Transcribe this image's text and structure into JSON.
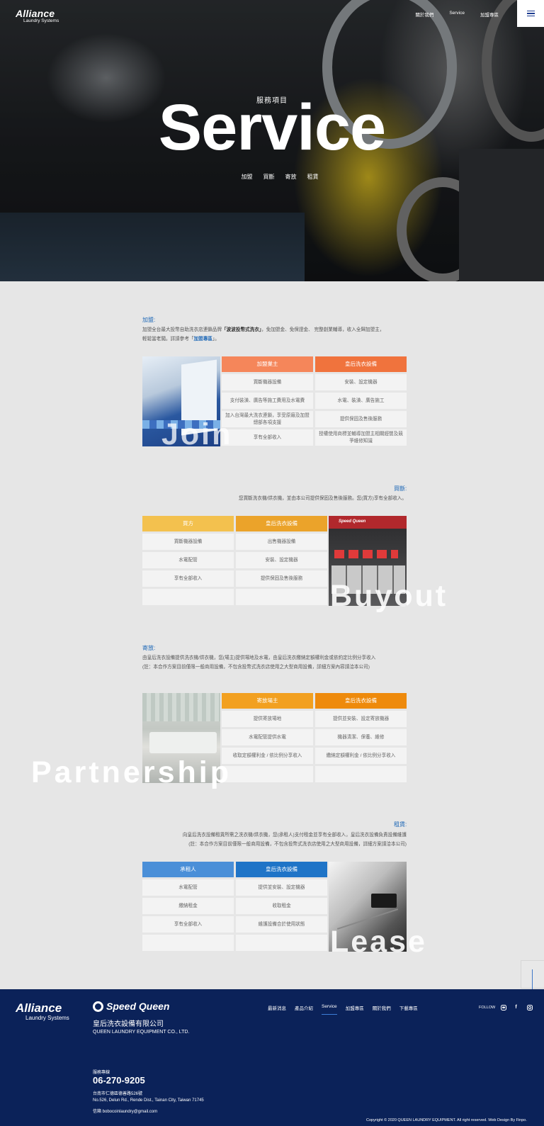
{
  "brand": {
    "logo_main": "Alliance",
    "logo_sub": "Laundry Systems"
  },
  "nav": {
    "items": [
      "關於我們",
      "Service",
      "加盟專區"
    ]
  },
  "hero": {
    "subtitle": "服務項目",
    "title": "Service",
    "links": [
      "加盟",
      "買斷",
      "寄放",
      "租賃"
    ]
  },
  "franchise": {
    "title": "加盟:",
    "desc_pre": "加盟全台最大投幣自助洗衣店連鎖品牌",
    "desc_brand": "「波波投幣式洗衣」",
    "desc_mid": "，免加盟金、免保證金、 完整創業輔導，收入全歸加盟主，",
    "desc_line2_pre": "輕鬆當老闆。詳請參考「",
    "desc_link": "加盟專區",
    "desc_line2_post": "」。",
    "headers": [
      "加盟業主",
      "皇后洗衣設備"
    ],
    "rows": [
      [
        "買斷機器設備",
        "安裝、設定機器"
      ],
      [
        "支付裝潢、廣告等施工費用及水電費",
        "水電、裝潢、廣告施工"
      ],
      [
        "加入台灣最大洗衣連鎖，享受原廠及加盟總部各項支援",
        "提供保固及售後服務"
      ],
      [
        "享有全部收入",
        "授權使用商標並輔導加盟主相關經營及競爭維修知識"
      ]
    ],
    "ghost": "Join",
    "colors": [
      "#f5865a",
      "#f0733d"
    ]
  },
  "buyout": {
    "title": "買斷:",
    "desc": "您買斷洗衣機/烘衣機，並由本公司提供保固及售後服務。您(買方)享有全部收入。",
    "headers": [
      "買方",
      "皇后洗衣設備"
    ],
    "rows": [
      [
        "買斷機器設備",
        "出售機器設備"
      ],
      [
        "水電配管",
        "安裝、設定機器"
      ],
      [
        "享有全部收入",
        "提供保固及售後服務"
      ],
      [
        "",
        ""
      ]
    ],
    "ghost": "Buyout",
    "photo_text": "Speed Queen",
    "colors": [
      "#f3c14e",
      "#eba32a"
    ]
  },
  "partnership": {
    "title": "寄放:",
    "desc1": "由皇后洗衣設備提供洗衣機/烘衣機，您(場主)提供場地及水電，由皇后洗衣繳納定額權利金或依約定比例分享收入",
    "desc2": "(註：本合作方案目前僅限一般商用設備，不包含投幣式洗衣店使用之大型商用設備，詳細方案內容請洽本公司)",
    "headers": [
      "寄放場主",
      "皇后洗衣設備"
    ],
    "rows": [
      [
        "提供寄放場地",
        "提供並安裝、設定寄放機器"
      ],
      [
        "水電配管提供水電",
        "機器清潔、保養、維修"
      ],
      [
        "收取定額權利金 / 依比例分享收入",
        "繳納定額權利金 / 依比例分享收入"
      ],
      [
        "",
        ""
      ]
    ],
    "ghost": "Partnership",
    "colors": [
      "#f2a020",
      "#ee8a0c"
    ]
  },
  "lease": {
    "title": "租賃:",
    "desc1": "向皇后洗衣設備租賃所需之洗衣機/烘衣機，您(承租人)支付租金並享有全部收入，皇后洗衣設備負責設備維護",
    "desc2": "(註：本合作方案目前僅限一般商用設備，不包含投幣式洗衣店使用之大型商用設備，詳細方案請洽本公司)",
    "headers": [
      "承租人",
      "皇后洗衣設備"
    ],
    "rows": [
      [
        "水電配管",
        "提供並安裝、設定機器"
      ],
      [
        "繳納租金",
        "收取租金"
      ],
      [
        "享有全部收入",
        "維護設備合於使用狀態"
      ],
      [
        "",
        ""
      ]
    ],
    "ghost": "Lease",
    "colors": [
      "#4a8fd8",
      "#1f74c7"
    ]
  },
  "footer": {
    "logo1_main": "Alliance",
    "logo1_sub": "Laundry Systems",
    "logo2": "Speed Queen",
    "company_zh": "皇后洗衣設備有限公司",
    "company_en": "QUEEN LAUNDRY EQUIPMENT CO., LTD.",
    "nav": [
      "最新消息",
      "產品介紹",
      "Service",
      "加盟專區",
      "關於我們",
      "下載專區"
    ],
    "active_nav": "Service",
    "follow": "FOLLOW",
    "social_icons": [
      "line-icon",
      "facebook-icon",
      "instagram-icon"
    ],
    "hotline_label": "服務專線",
    "hotline": "06-270-9205",
    "address_zh": "台南市仁德區德善路526號",
    "address_en": "No.526, Delun Rd., Rende Dist., Tainan City, Taiwan 71745",
    "email": "信箱 bobocoinlaundry@gmail.com",
    "copyright": "Copyright © 2020 QUEEN LAUNDRY EQUIPMENT. All right reserved. Web Design By Finpo."
  },
  "scroll_indicator": "1"
}
